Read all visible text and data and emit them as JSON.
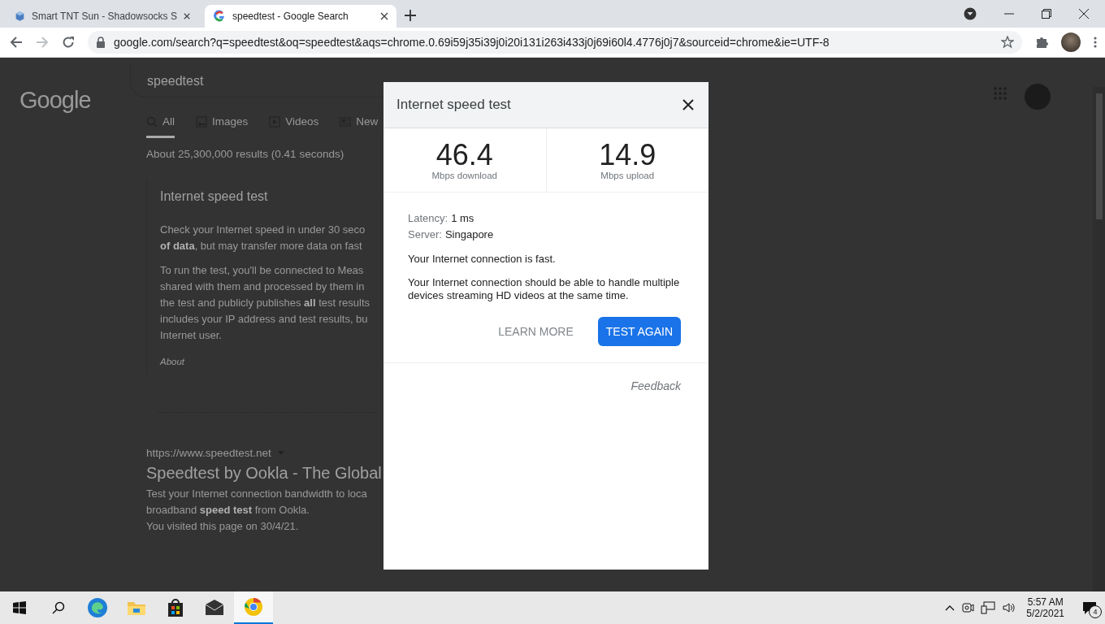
{
  "browser": {
    "tabs": [
      {
        "title": "Smart TNT Sun - Shadowsocks S",
        "selected": false,
        "kind": "cube"
      },
      {
        "title": "speedtest - Google Search",
        "selected": true,
        "kind": "google"
      }
    ],
    "url": "google.com/search?q=speedtest&oq=speedtest&aqs=chrome.0.69i59j35i39j0i20i131i263i433j0j69i60l4.4776j0j7&sourceid=chrome&ie=UTF-8"
  },
  "page": {
    "logo": "Google",
    "query": "speedtest",
    "search_tabs": [
      {
        "label": "All",
        "selected": true,
        "kind": "search"
      },
      {
        "label": "Images",
        "selected": false,
        "kind": "image"
      },
      {
        "label": "Videos",
        "selected": false,
        "kind": "video"
      },
      {
        "label": "New",
        "selected": false,
        "kind": "news"
      }
    ],
    "result_stats": "About 25,300,000 results (0.41 seconds)",
    "card": {
      "title": "Internet speed test",
      "paragraphs": [
        [
          "Check your Internet speed in under 30 seco",
          "**of data**, but may transfer more data on fast"
        ],
        [
          "To run the test, you'll be connected to Meas",
          "shared with them and processed by them in",
          "the test and publicly publishes **all** test results",
          "includes your IP address and test results, bu",
          "Internet user."
        ]
      ],
      "about": "About"
    },
    "result": {
      "url": "https://www.speedtest.net",
      "title": "Speedtest by Ookla - The Global",
      "snippet": [
        "Test your Internet connection bandwidth to loca",
        "broadband **speed test** from Ookla."
      ],
      "visited": "You visited this page on 30/4/21."
    }
  },
  "dialog": {
    "title": "Internet speed test",
    "stats": [
      {
        "value": "46.4",
        "label": "Mbps download"
      },
      {
        "value": "14.9",
        "label": "Mbps upload"
      }
    ],
    "details": [
      {
        "label": "Latency:",
        "value": "1 ms"
      },
      {
        "label": "Server:",
        "value": "Singapore"
      }
    ],
    "message": "Your Internet connection is fast.",
    "detail": "Your Internet connection should be able to handle multiple devices streaming HD videos at the same time.",
    "learn_more": "LEARN MORE",
    "test_again": "TEST AGAIN",
    "feedback": "Feedback"
  },
  "taskbar": {
    "apps": [
      {
        "kind": "edge",
        "active": false
      },
      {
        "kind": "explorer",
        "active": false
      },
      {
        "kind": "store",
        "active": false
      },
      {
        "kind": "mail",
        "active": false
      },
      {
        "kind": "chrome",
        "active": true
      }
    ],
    "time": "5:57 AM",
    "date": "5/2/2021",
    "notifications": "4"
  }
}
